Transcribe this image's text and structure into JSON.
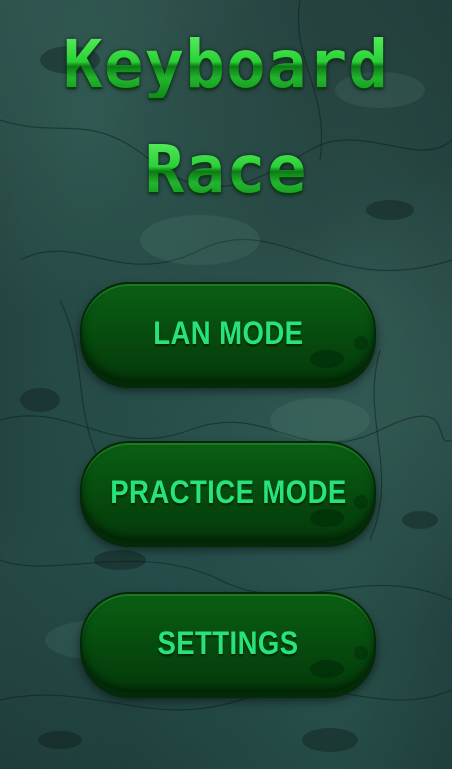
{
  "title": {
    "line1": "Keyboard",
    "line2": "Race"
  },
  "menu": {
    "lan_label": "LAN MODE",
    "practice_label": "PRACTICE MODE",
    "settings_label": "SETTINGS"
  },
  "colors": {
    "title_green": "#2ec43a",
    "button_green": "#064a0e",
    "button_text": "#28e27a",
    "background": "#1b3533"
  }
}
